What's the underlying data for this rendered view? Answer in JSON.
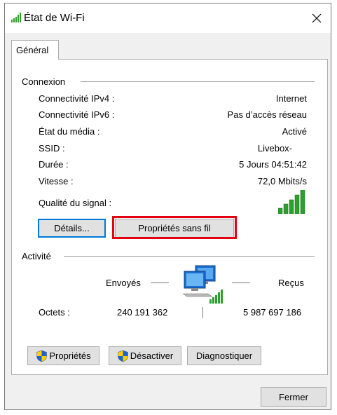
{
  "window": {
    "title": "État de Wi-Fi",
    "tab_label": "Général"
  },
  "connection": {
    "group_label": "Connexion",
    "rows": [
      {
        "label": "Connectivité IPv4 :",
        "value": "Internet"
      },
      {
        "label": "Connectivité IPv6 :",
        "value": "Pas d’accès réseau"
      },
      {
        "label": "État du média :",
        "value": "Activé"
      },
      {
        "label": "SSID :",
        "value": "Livebox-"
      },
      {
        "label": "Durée :",
        "value": "5 Jours 04:51:42"
      },
      {
        "label": "Vitesse :",
        "value": "72,0 Mbits/s"
      }
    ],
    "signal_label": "Qualité du signal :",
    "signal_bars_lit": 5,
    "details_button": "Détails...",
    "wireless_props_button": "Propriétés sans fil"
  },
  "activity": {
    "group_label": "Activité",
    "sent_label": "Envoyés",
    "received_label": "Reçus",
    "bytes_label": "Octets :",
    "bytes_sent": "240 191 362",
    "bytes_received": "5 987 697 186"
  },
  "actions": {
    "properties_button": "Propriétés",
    "disable_button": "Désactiver",
    "diagnose_button": "Diagnostiquer",
    "close_button": "Fermer"
  },
  "colors": {
    "signal_green": "#2e9e2e",
    "highlight_red": "#e3000f",
    "focus_blue": "#0078d7"
  }
}
